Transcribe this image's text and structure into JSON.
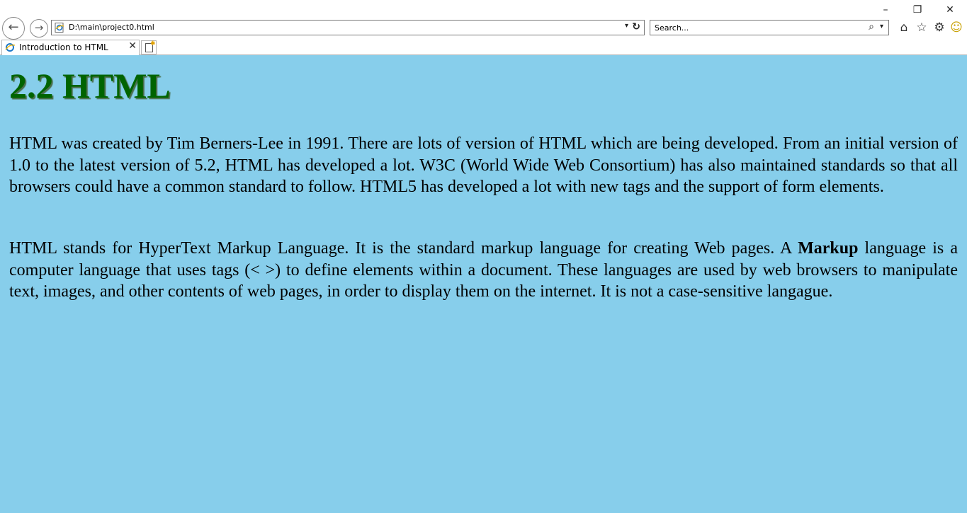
{
  "browser": {
    "window_controls": {
      "minimize": "–",
      "restore": "❐",
      "close": "✕"
    },
    "nav": {
      "back_glyph": "←",
      "forward_glyph": "→"
    },
    "address": {
      "value": "D:\\main\\project0.html",
      "dropdown_glyph": "▾",
      "refresh_glyph": "↻"
    },
    "search": {
      "placeholder": "Search...",
      "search_glyph": "⌕",
      "dropdown_glyph": "▾"
    },
    "tools": {
      "home_glyph": "⌂",
      "favorites_glyph": "☆",
      "settings_glyph": "⚙",
      "feedback_glyph": "☺"
    },
    "tab": {
      "title": "Introduction to HTML",
      "close_glyph": "✕"
    },
    "icons": [
      "ie-page-icon",
      "home-icon",
      "star-icon",
      "gear-icon",
      "smiley-icon",
      "new-tab-icon"
    ]
  },
  "page": {
    "heading": "2.2 HTML",
    "paragraph1": "HTML was created by Tim Berners-Lee in 1991. There are lots of version of HTML which are being developed. From an initial version of 1.0 to the latest version of 5.2, HTML has developed a lot. W3C (World Wide Web Consortium) has also maintained standards so that all browsers could have a common standard to follow. HTML5 has developed a lot with new tags and the support of form elements.",
    "paragraph2": {
      "before": "HTML stands for HyperText Markup Language. It is the standard markup language for creating Web pages. A ",
      "bold": "Markup",
      "after": " language is a computer language that uses tags (< >) to define elements within a document. These languages are used by web browsers to manipulate text, images, and other contents of web pages, in order to display them on the internet. It is not a case-sensitive langague."
    },
    "colors": {
      "background": "#87ceeb",
      "heading": "#006400",
      "text": "#000000"
    }
  }
}
